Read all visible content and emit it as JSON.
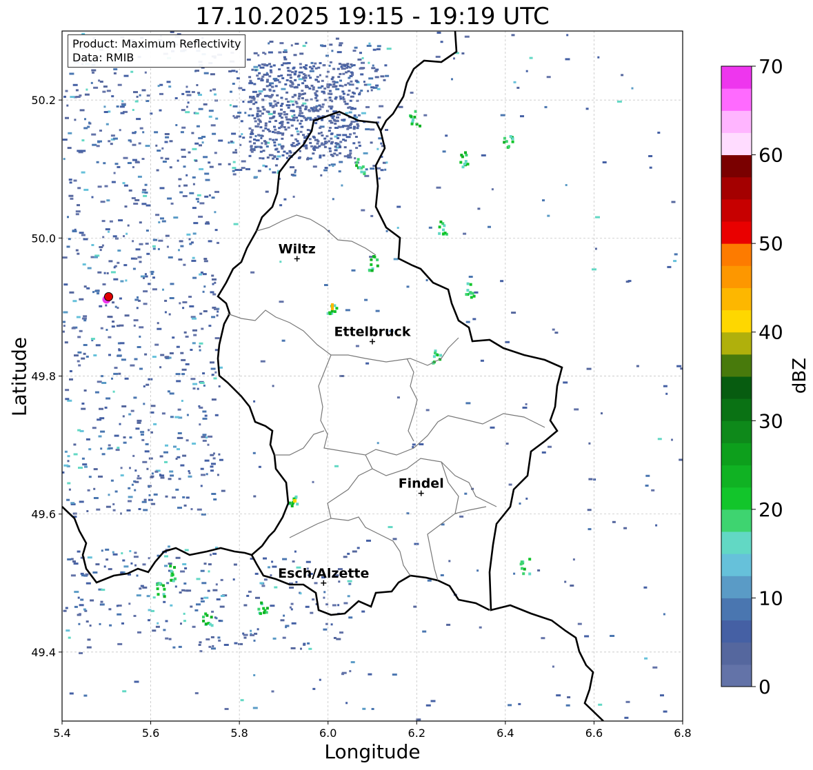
{
  "title": "17.10.2025 19:15 - 19:19 UTC",
  "info": {
    "product_line": "Product: Maximum Reflectivity",
    "data_line": "Data: RMIB"
  },
  "axes": {
    "xlabel": "Longitude",
    "ylabel": "Latitude",
    "xlim": [
      5.4,
      6.8
    ],
    "ylim": [
      49.3,
      50.3
    ],
    "xticks": [
      "5.4",
      "5.6",
      "5.8",
      "6.0",
      "6.2",
      "6.4",
      "6.6",
      "6.8"
    ],
    "yticks": [
      "49.4",
      "49.6",
      "49.8",
      "50.0",
      "50.2"
    ]
  },
  "colorbar": {
    "label": "dBZ",
    "range": [
      0,
      70
    ],
    "ticks": [
      "0",
      "10",
      "20",
      "30",
      "40",
      "50",
      "60",
      "70"
    ],
    "colors": [
      "#6373a8",
      "#55679e",
      "#4560a4",
      "#4a76b0",
      "#5a9bc6",
      "#66c1da",
      "#62d8c4",
      "#3ed470",
      "#12c52b",
      "#10b223",
      "#0d9f1c",
      "#0e891a",
      "#0a7214",
      "#075c10",
      "#487a0c",
      "#b0b00c",
      "#fed700",
      "#fdb700",
      "#fd9700",
      "#fd7b00",
      "#e90000",
      "#c70000",
      "#a40000",
      "#7a0000",
      "#ffdcff",
      "#ffb5ff",
      "#ff6aff",
      "#ee36ee"
    ]
  },
  "cities": [
    {
      "name": "Wiltz",
      "lon": 5.93,
      "lat": 49.97
    },
    {
      "name": "Ettelbruck",
      "lon": 6.1,
      "lat": 49.85
    },
    {
      "name": "Findel",
      "lon": 6.21,
      "lat": 49.63
    },
    {
      "name": "Esch/Alzette",
      "lon": 5.99,
      "lat": 49.5
    }
  ],
  "radar_site": {
    "lon": 5.505,
    "lat": 49.915
  }
}
